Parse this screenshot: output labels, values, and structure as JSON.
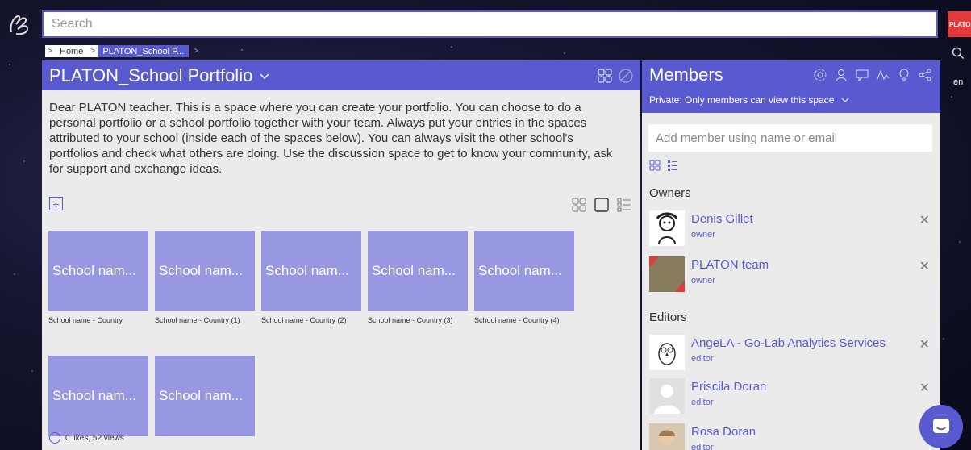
{
  "search": {
    "placeholder": "Search"
  },
  "platon_badge": "PLATON",
  "language": "en",
  "breadcrumb": {
    "home": "Home",
    "current": "PLATON_School P..."
  },
  "main": {
    "title": "PLATON_School Portfolio",
    "description": "Dear PLATON teacher. This is a space where you can create your portfolio. You can choose to do a personal portfolio or a school portfolio together with your team. Always put your entries in the spaces attributed to your school (inside each of the spaces below). You can always visit the other school's portfolios and check what others are doing. Use the discussion space to get to know your community, ask for support and exchange ideas.",
    "tiles": [
      {
        "card": "School nam...",
        "caption": "School name - Country"
      },
      {
        "card": "School nam...",
        "caption": "School name - Country (1)"
      },
      {
        "card": "School nam...",
        "caption": "School name - Country (2)"
      },
      {
        "card": "School nam...",
        "caption": "School name - Country (3)"
      },
      {
        "card": "School nam...",
        "caption": "School name - Country (4)"
      },
      {
        "card": "School nam...",
        "caption": ""
      },
      {
        "card": "School nam...",
        "caption": ""
      }
    ],
    "likes": "0 likes, 52 views"
  },
  "members": {
    "title": "Members",
    "privacy": "Private: Only members can view this space",
    "add_placeholder": "Add member using name or email",
    "owners_label": "Owners",
    "editors_label": "Editors",
    "owners": [
      {
        "name": "Denis Gillet",
        "role": "owner"
      },
      {
        "name": "PLATON team",
        "role": "owner"
      }
    ],
    "editors": [
      {
        "name": "AngeLA - Go-Lab Analytics Services",
        "role": "editor"
      },
      {
        "name": "Priscila Doran",
        "role": "editor"
      },
      {
        "name": "Rosa Doran",
        "role": "editor"
      }
    ]
  },
  "colors": {
    "accent": "#5a5ad0",
    "tile": "#9898e2",
    "panel": "#ebebeb"
  }
}
